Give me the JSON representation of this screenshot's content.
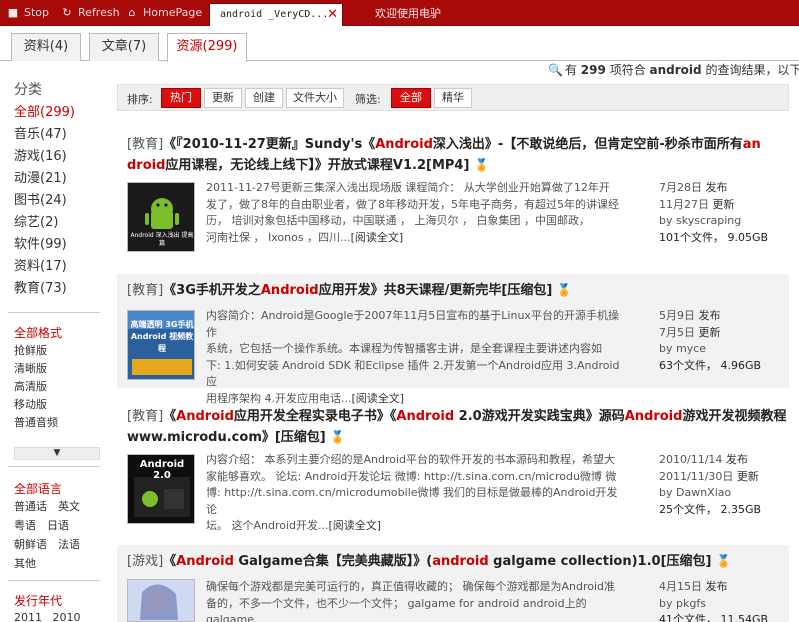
{
  "toolbar": {
    "stop": "Stop",
    "refresh": "Refresh",
    "homepage": "HomePage",
    "active_tab": "android _VeryCD...",
    "other_tab": "欢迎使用电驴"
  },
  "subtabs": [
    "资料(4)",
    "文章(7)",
    "资源(299)"
  ],
  "results": {
    "prefix": "有",
    "count": "299",
    "mid": "项符合",
    "query": "android",
    "suffix": "的查询结果，以下是第"
  },
  "sidebar": {
    "title": "分类",
    "categories": [
      "全部(299)",
      "音乐(47)",
      "游戏(16)",
      "动漫(21)",
      "图书(24)",
      "综艺(2)",
      "软件(99)",
      "资料(17)",
      "教育(73)"
    ],
    "format_title": "全部格式",
    "formats": [
      "抢鲜版",
      "清晰版",
      "高清版",
      "移动版",
      "普通音频"
    ],
    "more_icon": "chevron-down-icon",
    "lang_title": "全部语言",
    "langs": [
      [
        "普通话",
        "英文"
      ],
      [
        "粤语",
        "日语"
      ],
      [
        "朝鲜语",
        "法语"
      ],
      [
        "其他"
      ]
    ],
    "year_title": "发行年代",
    "years": "2011   2010"
  },
  "sortbar": {
    "sort_label": "排序:",
    "sorts": [
      "热门",
      "更新",
      "创建",
      "文件大小"
    ],
    "filter_label": "筛选:",
    "filters": [
      "全部",
      "精华"
    ]
  },
  "items": [
    {
      "tag": "[教育]",
      "title_parts": [
        "《『2010-11-27更新』Sundy's《",
        "Android",
        "深入浅出》-【不敢说绝后，但肯定空前-秒杀市面所有",
        "an",
        "droid",
        "应用课程，无论线上线下】》开放式课程V1.2[MP4]"
      ],
      "desc_lines": [
        "2011-11-27号更新三集深入浅出现场版  课程简介：  从大学创业开始算做了12年开",
        "发了，做了8年的自由职业者，做了8年移动开发，5年电子商务，有超过5年的讲课经",
        "历，  培训对象包括中国移动，中国联通  ，  上海贝尔  ，  白象集团  ，中国邮政，",
        "河南社保  ，    Ixonos  ，四川..."
      ],
      "read_more": "[阅读全文]",
      "thumb_text": "Android 深入浅出 提高篇",
      "meta": [
        [
          "7月28日",
          "发布"
        ],
        [
          "11月27日",
          "更新"
        ],
        [
          "by",
          "skyscraping"
        ],
        [
          "101个文件，",
          "9.05GB"
        ]
      ]
    },
    {
      "tag": "[教育]",
      "title_parts": [
        "《3G手机开发之",
        "Android",
        "应用开发》共8天课程/更新完毕[压缩包]"
      ],
      "desc_lines": [
        "内容简介：Android是Google于2007年11月5日宣布的基于Linux平台的开源手机操作",
        "系统，它包括一个操作系统。本课程为传智播客主讲，是全套课程主要讲述内容如",
        "下: 1.如何安装  Android SDK 和Eclipse 插件  2.开发第一个Android应用  3.Android应",
        "用程序架构  4.开发应用电话..."
      ],
      "read_more": "[阅读全文]",
      "thumb_text": "高端透明 3G手机 Android 视频教程",
      "meta": [
        [
          "5月9日",
          "发布"
        ],
        [
          "7月5日",
          "更新"
        ],
        [
          "by",
          "myce"
        ],
        [
          "63个文件，",
          "4.96GB"
        ]
      ]
    },
    {
      "tag": "[教育]",
      "title_parts": [
        "《",
        "Android",
        "应用开发全程实录电子书》《",
        "Android",
        " 2.0游戏开发实践宝典》源码",
        "Android",
        "游戏开发视频教程www.microdu.com》[压缩包]"
      ],
      "desc_lines": [
        "内容介绍：  本系列主要介绍的是Android平台的软件开发的书本源码和教程，希望大",
        "家能够喜欢。  论坛: Android开发论坛  微博: http://t.sina.com.cn/microdu微博  微",
        "博: http://t.sina.com.cn/microdumobile微博  我们的目标是做最棒的Android开发论",
        "坛。  这个Android开发..."
      ],
      "read_more": "[阅读全文]",
      "thumb_text": "Android 2.0",
      "meta": [
        [
          "2010/11/14",
          "发布"
        ],
        [
          "2011/11/30日",
          "更新"
        ],
        [
          "by",
          "DawnXiao"
        ],
        [
          "25个文件，",
          "2.35GB"
        ]
      ]
    },
    {
      "tag": "[游戏]",
      "title_parts": [
        "《",
        "Android",
        " Galgame合集【完美典藏版】》(",
        "android",
        " galgame collection)1.0[压缩包]"
      ],
      "desc_lines": [
        "确保每个游戏都是完美可运行的，真正值得收藏的；  确保每个游戏都是为Android准",
        "备的，不多一个文件，也不少一个文件；   galgame for android android上的galgame",
        "..."
      ],
      "read_more": "",
      "thumb_text": "",
      "meta": [
        [
          "4月15日",
          "发布"
        ],
        [
          "by",
          "pkgfs"
        ],
        [
          "41个文件，",
          "11.54GB"
        ]
      ]
    }
  ]
}
